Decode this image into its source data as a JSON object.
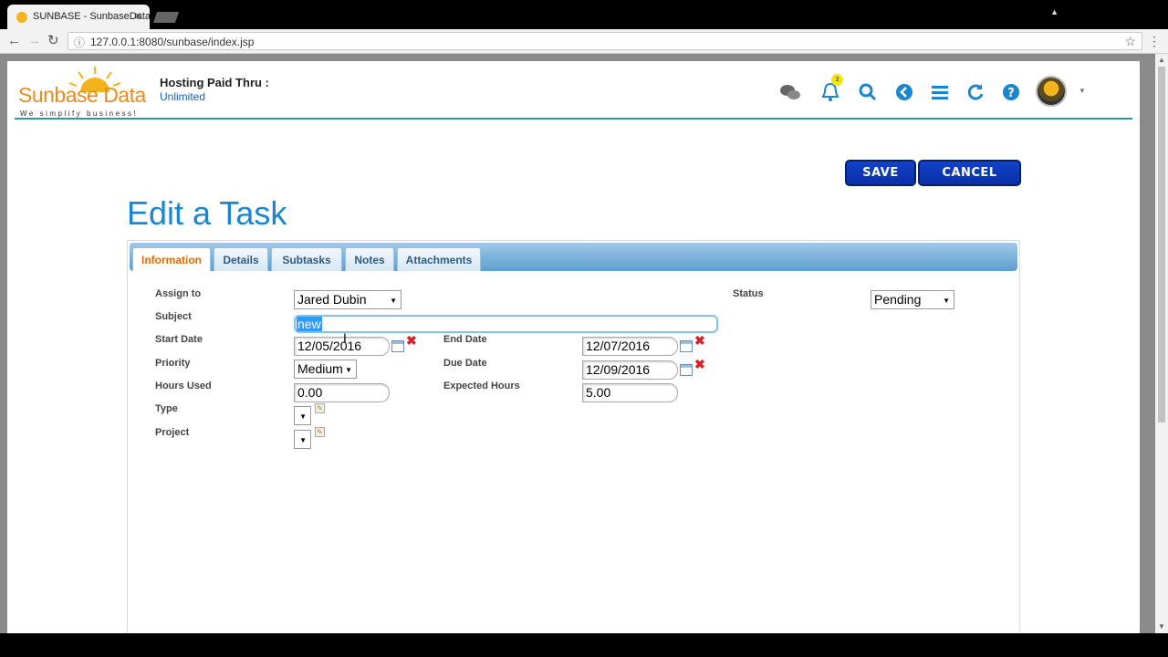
{
  "browser": {
    "tab_title": "SUNBASE - SunbaseData",
    "url": "127.0.0.1:8080/sunbase/index.jsp"
  },
  "header": {
    "logo_text": "Sunbase Data",
    "logo_tagline": "We simplify business!",
    "hosting_label": "Hosting Paid Thru :",
    "hosting_value": "Unlimited",
    "notification_count": "3",
    "icons": [
      "chat-icon",
      "bell-icon",
      "search-icon",
      "back-icon",
      "menu-icon",
      "refresh-icon",
      "help-icon"
    ]
  },
  "actions": {
    "save": "SAVE",
    "cancel": "CANCEL"
  },
  "page_title": "Edit a Task",
  "tabs": [
    "Information",
    "Details",
    "Subtasks",
    "Notes",
    "Attachments"
  ],
  "form": {
    "assign_to": {
      "label": "Assign to",
      "value": "Jared Dubin"
    },
    "status": {
      "label": "Status",
      "value": "Pending"
    },
    "subject": {
      "label": "Subject",
      "value": "new"
    },
    "start_date": {
      "label": "Start Date",
      "value": "12/05/2016"
    },
    "end_date": {
      "label": "End Date",
      "value": "12/07/2016"
    },
    "priority": {
      "label": "Priority",
      "value": "Medium"
    },
    "due_date": {
      "label": "Due Date",
      "value": "12/09/2016"
    },
    "hours_used": {
      "label": "Hours Used",
      "value": "0.00"
    },
    "expected_hours": {
      "label": "Expected Hours",
      "value": "5.00"
    },
    "type": {
      "label": "Type",
      "value": ""
    },
    "project": {
      "label": "Project",
      "value": ""
    }
  },
  "colors": {
    "accent": "#1a86d0",
    "button": "#0a2fa8",
    "header_rule": "#2a9a98",
    "logo": "#e88c1c"
  }
}
